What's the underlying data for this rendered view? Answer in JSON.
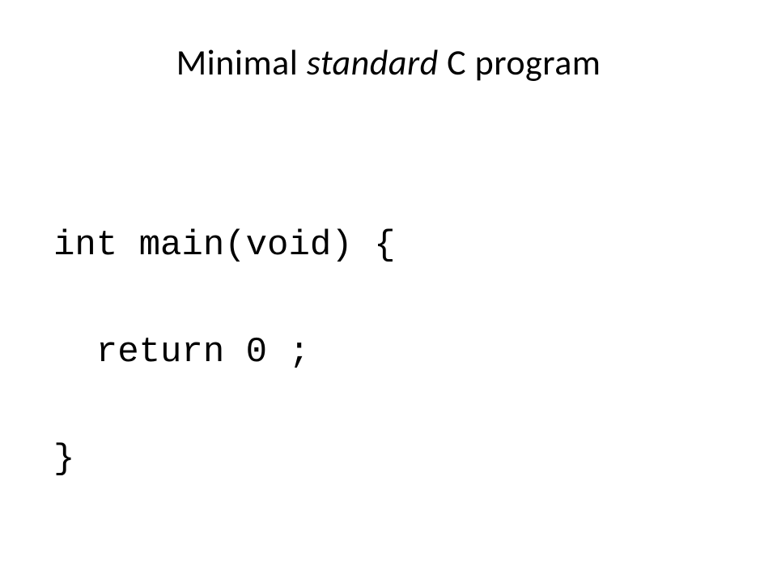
{
  "slide": {
    "title_prefix": "Minimal ",
    "title_italic": "standard",
    "title_suffix": " C program",
    "code_line1": "int main(void) {",
    "code_line2": "  return 0 ;",
    "code_line3": "}"
  }
}
